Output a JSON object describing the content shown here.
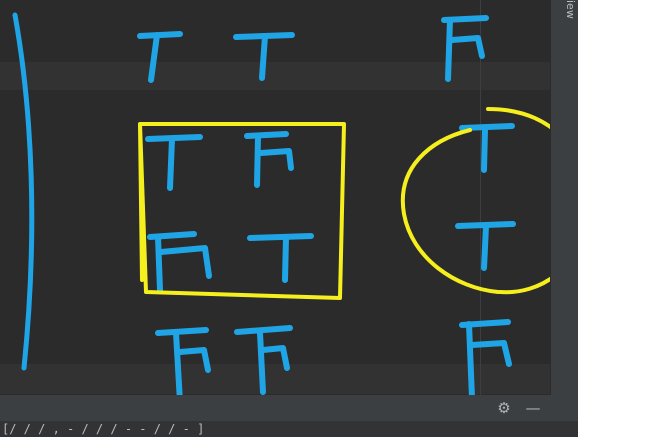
{
  "sidebar": {
    "tab_label": "iew"
  },
  "bottom_bar": {
    "settings_icon": "gear-icon",
    "minimize_icon": "minimize-icon",
    "gear_glyph": "⚙",
    "minimize_glyph": "—"
  },
  "status_bar": {
    "text": "[/  /  /  ,  -  /  /  /  -  -  /  /  -  ]"
  },
  "annotation": {
    "pen_color": "#1fa5e6",
    "highlight_color": "#f5ef1e",
    "grid": [
      [
        "T",
        "T",
        "F"
      ],
      [
        "T",
        "F",
        "T"
      ],
      [
        "F",
        "T",
        "T"
      ],
      [
        "F",
        "F",
        "F"
      ]
    ]
  },
  "colors": {
    "editor_bg": "#2b2b2b",
    "band_bg": "#323232",
    "panel_bg": "#3c3f41"
  }
}
